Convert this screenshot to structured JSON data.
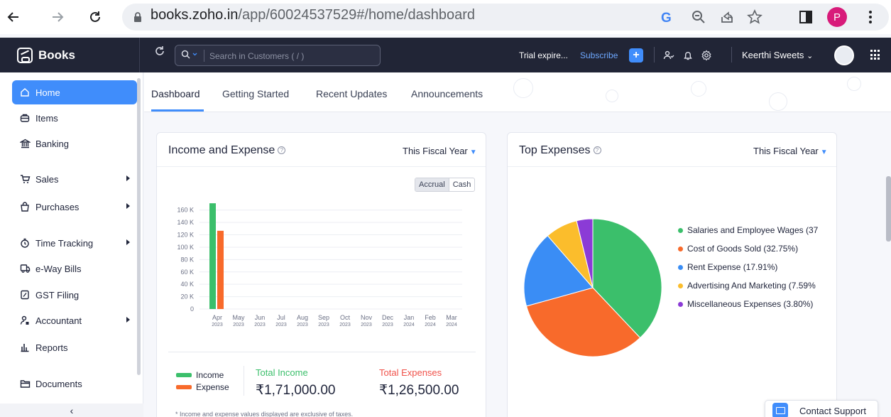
{
  "browser": {
    "url_host": "books.zoho.in",
    "url_path": "/app/60024537529#/home/dashboard",
    "profile_initial": "P"
  },
  "header": {
    "brand": "Books",
    "search_placeholder": "Search in Customers ( / )",
    "trial_text": "Trial expire...",
    "subscribe_label": "Subscribe",
    "org_name": "Keerthi Sweets",
    "org_chevron": "⌄"
  },
  "sidebar": {
    "items": [
      {
        "label": "Home",
        "icon": "home-icon",
        "glyph": "⌂"
      },
      {
        "label": "Items",
        "icon": "items-icon",
        "glyph": "⊖"
      },
      {
        "label": "Banking",
        "icon": "bank-icon",
        "glyph": "⌂"
      },
      {
        "label": "Sales",
        "icon": "cart-icon",
        "glyph": "⊻"
      },
      {
        "label": "Purchases",
        "icon": "bag-icon",
        "glyph": "⊓"
      },
      {
        "label": "Time Tracking",
        "icon": "stopwatch-icon",
        "glyph": "⏱"
      },
      {
        "label": "e-Way Bills",
        "icon": "truck-icon",
        "glyph": "⊡"
      },
      {
        "label": "GST Filing",
        "icon": "document-icon",
        "glyph": "⊠"
      },
      {
        "label": "Accountant",
        "icon": "accountant-icon",
        "glyph": "⚲"
      },
      {
        "label": "Reports",
        "icon": "reports-icon",
        "glyph": "⫴"
      },
      {
        "label": "Documents",
        "icon": "folder-icon",
        "glyph": "⊟"
      }
    ],
    "collapse_glyph": "‹"
  },
  "tabs": [
    "Dashboard",
    "Getting Started",
    "Recent Updates",
    "Announcements"
  ],
  "income_card": {
    "title": "Income and Expense",
    "period": "This Fiscal Year",
    "toggle": [
      "Accrual",
      "Cash"
    ],
    "legend_income": "Income",
    "legend_expense": "Expense",
    "total_income_label": "Total Income",
    "total_income_value": "₹1,71,000.00",
    "total_expense_label": "Total Expenses",
    "total_expense_value": "₹1,26,500.00",
    "footnote": "* Income and expense values displayed are exclusive of taxes."
  },
  "expenses_card": {
    "title": "Top Expenses",
    "period": "This Fiscal Year"
  },
  "contact_support": "Contact Support",
  "colors": {
    "income": "#3bbf6b",
    "expense": "#f86a2b",
    "accent": "#408dfb",
    "header": "#212536"
  },
  "chart_data": [
    {
      "type": "bar",
      "categories": [
        "Apr 2023",
        "May 2023",
        "Jun 2023",
        "Jul 2023",
        "Aug 2023",
        "Sep 2023",
        "Oct 2023",
        "Nov 2023",
        "Dec 2023",
        "Jan 2024",
        "Feb 2024",
        "Mar 2024"
      ],
      "tick_months": [
        "Apr",
        "May",
        "Jun",
        "Jul",
        "Aug",
        "Sep",
        "Oct",
        "Nov",
        "Dec",
        "Jan",
        "Feb",
        "Mar"
      ],
      "tick_years": [
        "2023",
        "2023",
        "2023",
        "2023",
        "2023",
        "2023",
        "2023",
        "2023",
        "2023",
        "2024",
        "2024",
        "2024"
      ],
      "series": [
        {
          "name": "Income",
          "color": "#3bbf6b",
          "values": [
            171000,
            0,
            0,
            0,
            0,
            0,
            0,
            0,
            0,
            0,
            0,
            0
          ]
        },
        {
          "name": "Expense",
          "color": "#f86a2b",
          "values": [
            126500,
            0,
            0,
            0,
            0,
            0,
            0,
            0,
            0,
            0,
            0,
            0
          ]
        }
      ],
      "yticks": [
        0,
        20000,
        40000,
        60000,
        80000,
        100000,
        120000,
        140000,
        160000
      ],
      "ytick_labels": [
        "0",
        "20 K",
        "40 K",
        "60 K",
        "80 K",
        "100 K",
        "120 K",
        "140 K",
        "160 K"
      ],
      "ylim": [
        0,
        170000
      ],
      "grid": true
    },
    {
      "type": "pie",
      "labels": [
        "Salaries and Employee Wages (37",
        "Cost of Goods Sold (32.75%)",
        "Rent Expense (17.91%)",
        "Advertising And Marketing (7.59%",
        "Miscellaneous Expenses (3.80%)"
      ],
      "values": [
        37.95,
        32.75,
        17.91,
        7.59,
        3.8
      ],
      "colors": [
        "#3bbf6b",
        "#f86a2b",
        "#3a8df5",
        "#fbbd2c",
        "#8b3bd6"
      ],
      "legend_position": "right"
    }
  ]
}
